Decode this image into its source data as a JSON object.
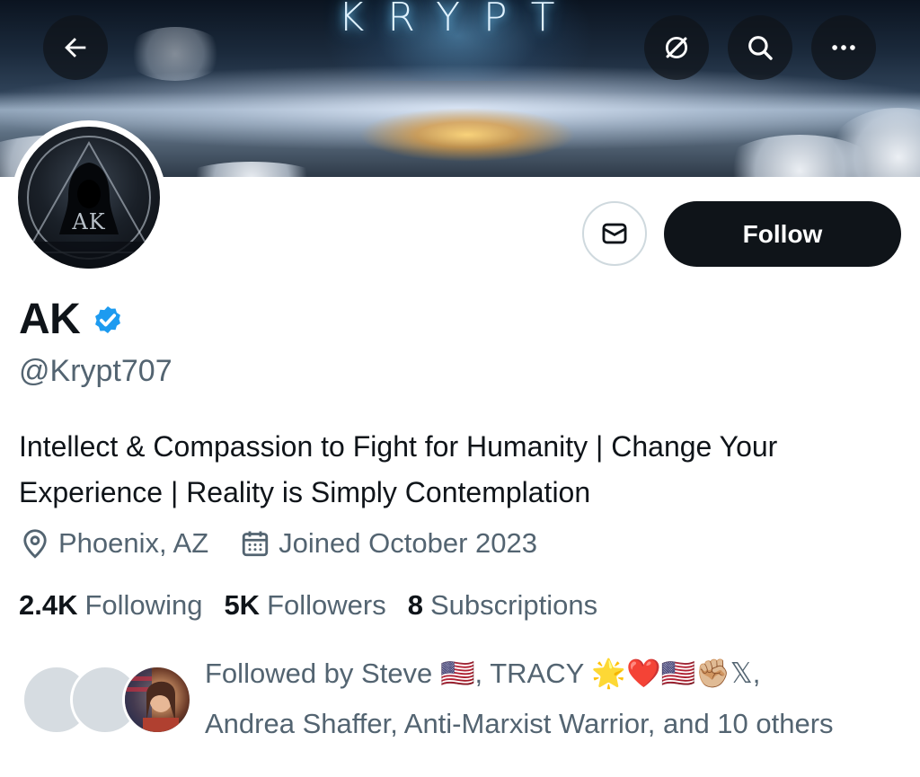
{
  "header": {
    "banner_title": "KRYPT",
    "back_icon": "arrow-left-icon",
    "actions": [
      {
        "name": "grok-icon"
      },
      {
        "name": "search-icon"
      },
      {
        "name": "more-horizontal-icon"
      }
    ]
  },
  "profile": {
    "avatar_text": "AK",
    "display_name": "AK",
    "verified": true,
    "verified_color": "#1d9bf0",
    "handle": "@Krypt707",
    "bio": "Intellect & Compassion to Fight for Humanity | Change Your Experience | Reality is Simply Contemplation",
    "location": "Phoenix, AZ",
    "joined": "Joined October 2023"
  },
  "actions": {
    "message_icon": "envelope-icon",
    "follow_label": "Follow"
  },
  "stats": {
    "following_count": "2.4K",
    "following_label": "Following",
    "followers_count": "5K",
    "followers_label": "Followers",
    "subscriptions_count": "8",
    "subscriptions_label": "Subscriptions"
  },
  "followed_by": {
    "prefix": "Followed by ",
    "name1": "Steve",
    "name1_emoji": "🇺🇸",
    "name2": "TRACY",
    "name2_emoji": "🌟❤️🇺🇸✊🏼𝕏",
    "rest": "Andrea Shaffer, Anti-Marxist Warrior, and 10 others"
  }
}
